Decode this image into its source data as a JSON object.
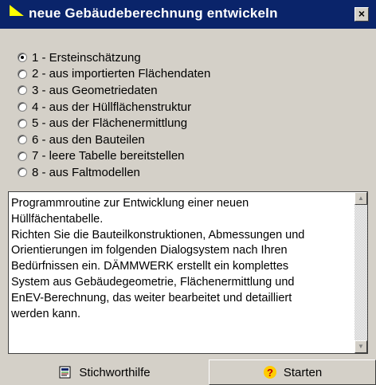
{
  "window": {
    "title": "neue Gebäudeberechnung entwickeln",
    "close_label": "×"
  },
  "options": [
    {
      "label": "1 - Ersteinschätzung",
      "checked": true
    },
    {
      "label": "2 - aus importierten Flächendaten",
      "checked": false
    },
    {
      "label": "3 - aus Geometriedaten",
      "checked": false
    },
    {
      "label": "4 - aus der Hüllflächenstruktur",
      "checked": false
    },
    {
      "label": "5 - aus der Flächenermittlung",
      "checked": false
    },
    {
      "label": "6 - aus den Bauteilen",
      "checked": false
    },
    {
      "label": "7 - leere Tabelle bereitstellen",
      "checked": false
    },
    {
      "label": "8 - aus Faltmodellen",
      "checked": false
    }
  ],
  "description": "Programmroutine zur Entwicklung einer neuen\nHüllfächentabelle.\nRichten Sie die Bauteilkonstruktionen, Abmessungen und\nOrientierungen im folgenden Dialogsystem nach Ihren\nBedürfnissen ein. DÄMMWERK erstellt ein komplettes\nSystem aus Gebäudegeometrie, Flächenermittlung und\nEnEV-Berechnung, das weiter bearbeitet und detailliert\nwerden kann.",
  "buttons": {
    "help_label": "Stichworthilfe",
    "start_label": "Starten"
  },
  "icons": {
    "title": "window-app-icon",
    "help": "help-book-icon",
    "start": "question-mark-icon"
  },
  "colors": {
    "titlebar": "#0a246a",
    "dialog": "#d4d0c8",
    "start_icon": "#ffcc00"
  }
}
